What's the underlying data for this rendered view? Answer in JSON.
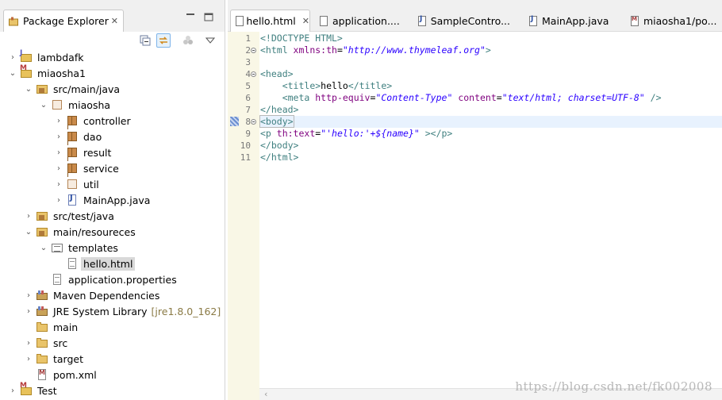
{
  "left_view": {
    "title": "Package Explorer",
    "close": "✕",
    "minimize": "▭",
    "maximize": "☐",
    "view_menu": "▽"
  },
  "tree": [
    {
      "label": "lambdafk",
      "icon": "project-icon",
      "expanded": false
    },
    {
      "label": "miaosha1",
      "icon": "maven-project-icon",
      "expanded": true
    },
    {
      "label": "src/main/java",
      "icon": "source-folder-icon",
      "expanded": true
    },
    {
      "label": "miaosha",
      "icon": "package-icon",
      "expanded": true
    },
    {
      "label": "controller",
      "icon": "package-icon",
      "expanded": false
    },
    {
      "label": "dao",
      "icon": "package-icon",
      "expanded": false
    },
    {
      "label": "result",
      "icon": "package-icon",
      "expanded": false
    },
    {
      "label": "service",
      "icon": "package-icon",
      "expanded": false
    },
    {
      "label": "util",
      "icon": "package-icon",
      "expanded": false
    },
    {
      "label": "MainApp.java",
      "icon": "java-file-icon",
      "expanded": false
    },
    {
      "label": "src/test/java",
      "icon": "source-folder-icon",
      "expanded": false
    },
    {
      "label": "main/resoureces",
      "icon": "source-folder-icon",
      "expanded": true
    },
    {
      "label": "templates",
      "icon": "templates-folder-icon",
      "expanded": true
    },
    {
      "label": "hello.html",
      "icon": "html-file-icon",
      "selected": true
    },
    {
      "label": "application.properties",
      "icon": "properties-file-icon"
    },
    {
      "label": "Maven Dependencies",
      "icon": "library-icon",
      "expanded": false
    },
    {
      "label": "JRE System Library",
      "decoration": "[jre1.8.0_162]",
      "icon": "library-icon",
      "expanded": false
    },
    {
      "label": "main",
      "icon": "folder-icon"
    },
    {
      "label": "src",
      "icon": "folder-icon",
      "expanded": false
    },
    {
      "label": "target",
      "icon": "folder-icon",
      "expanded": false
    },
    {
      "label": "pom.xml",
      "icon": "xml-file-icon"
    },
    {
      "label": "Test",
      "icon": "maven-project-icon",
      "expanded": false
    }
  ],
  "editor": {
    "tabs": [
      {
        "label": "hello.html",
        "active": true,
        "close": "✕"
      },
      {
        "label": "application....",
        "active": false
      },
      {
        "label": "SampleContro...",
        "active": false
      },
      {
        "label": "MainApp.java",
        "active": false
      },
      {
        "label": "miaosha1/po...",
        "active": false
      }
    ],
    "current_line": 8,
    "lines": [
      {
        "n": "1",
        "fold": false
      },
      {
        "n": "2",
        "fold": true
      },
      {
        "n": "3",
        "fold": false
      },
      {
        "n": "4",
        "fold": true
      },
      {
        "n": "5",
        "fold": false
      },
      {
        "n": "6",
        "fold": false
      },
      {
        "n": "7",
        "fold": false
      },
      {
        "n": "8",
        "fold": true
      },
      {
        "n": "9",
        "fold": false
      },
      {
        "n": "10",
        "fold": false
      },
      {
        "n": "11",
        "fold": false
      }
    ],
    "code": {
      "l1": "<!DOCTYPE HTML>",
      "l2_open": "<html ",
      "l2_attr": "xmlns:th",
      "l2_eq": "=",
      "l2_val": "\"http://www.thymeleaf.org\"",
      "l2_close": ">",
      "l4": "<head>",
      "l5_indent": "    ",
      "l5_open": "<title>",
      "l5_text": "hello",
      "l5_close": "</title>",
      "l6_indent": "    ",
      "l6_open": "<meta ",
      "l6_attr1": "http-equiv",
      "l6_eq1": "=",
      "l6_val1": "\"Content-Type\"",
      "l6_sp": " ",
      "l6_attr2": "content",
      "l6_eq2": "=",
      "l6_val2": "\"text/html; charset=UTF-8\"",
      "l6_close": " />",
      "l7": "</head>",
      "l8": "<body>",
      "l9_open": "<p ",
      "l9_attr": "th:text",
      "l9_eq": "=",
      "l9_val": "\"'hello:'+${name}\"",
      "l9_close": " ></p>",
      "l10": "</body>",
      "l11": "</html>"
    }
  },
  "watermark": "https://blog.csdn.net/fk002008"
}
